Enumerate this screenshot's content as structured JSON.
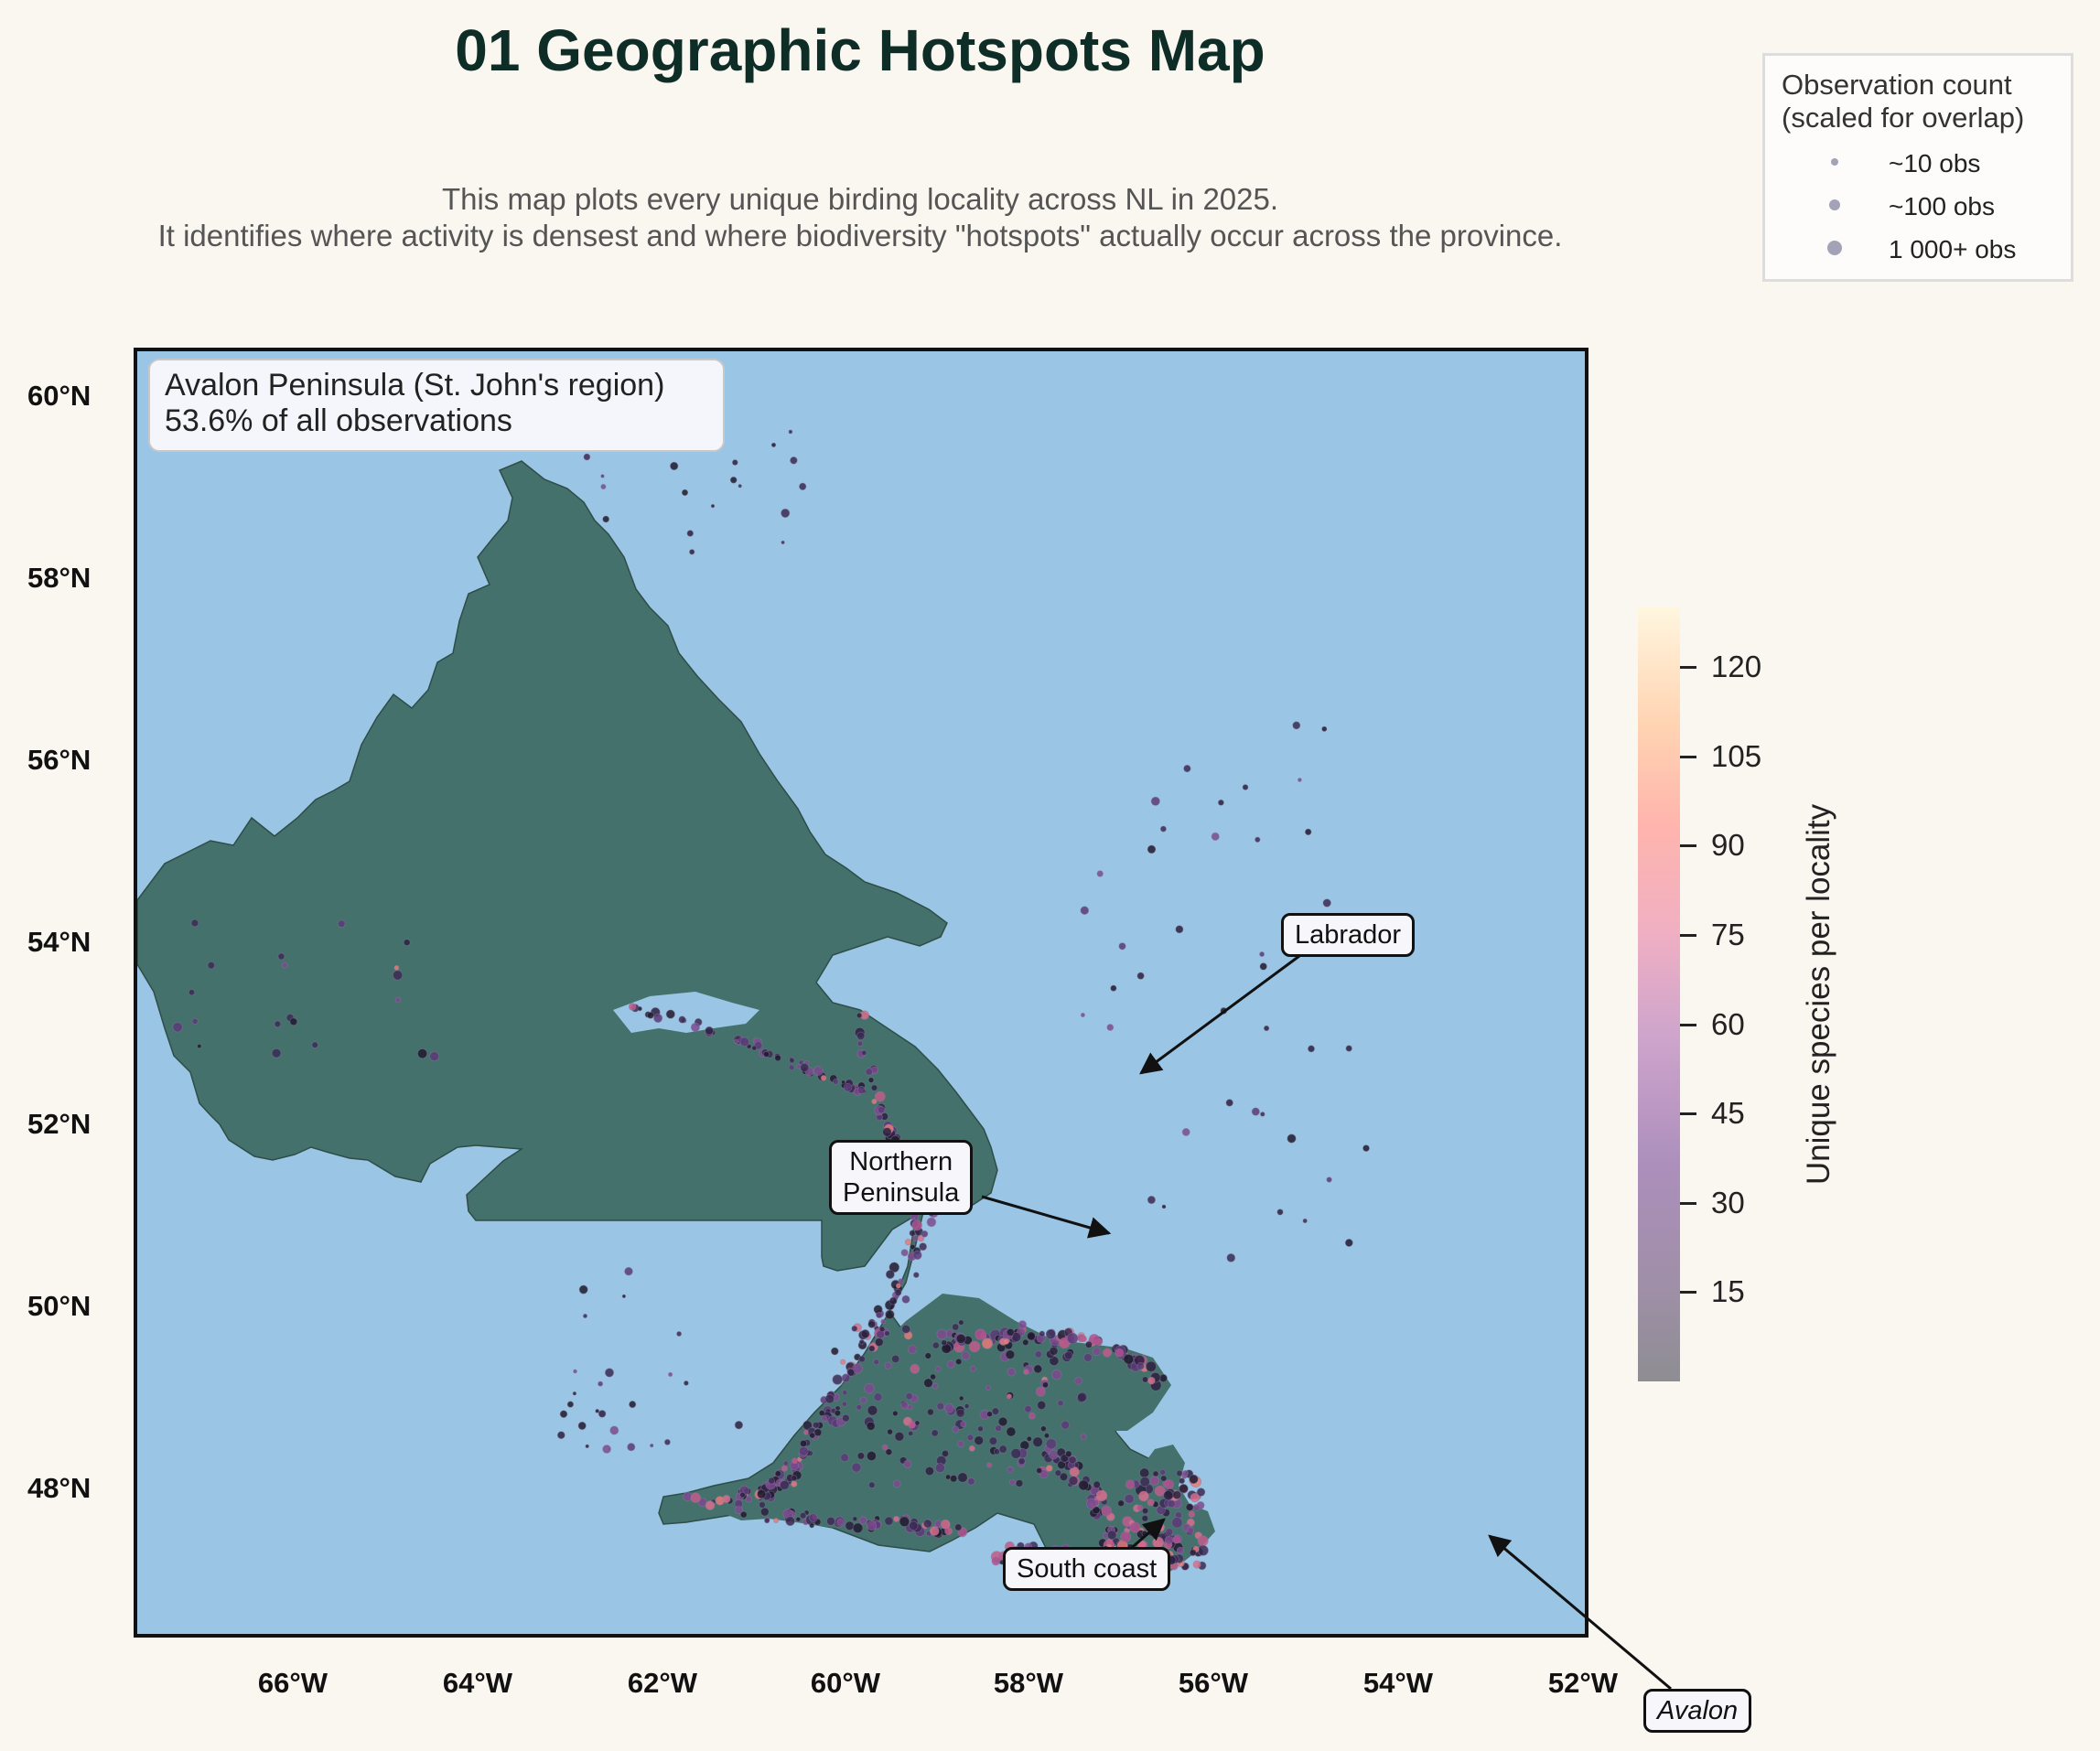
{
  "title": "01 Geographic Hotspots Map",
  "subtitle": {
    "line1": "This map plots every unique birding locality across NL in 2025.",
    "line2": "It identifies where activity is densest and where biodiversity \"hotspots\" actually occur across the province."
  },
  "legend": {
    "title_line1": "Observation count",
    "title_line2": "(scaled for overlap)",
    "items": [
      {
        "label": "~10 obs",
        "obs": 10
      },
      {
        "label": "~100 obs",
        "obs": 100
      },
      {
        "label": "1 000+ obs",
        "obs": 1000
      }
    ]
  },
  "inset": {
    "line1": "Avalon Peninsula (St. John's region)",
    "line2": "53.6% of all observations"
  },
  "annotations": [
    {
      "label": "Labrador",
      "style": "normal"
    },
    {
      "label_line1": "Northern",
      "label_line2": "Peninsula",
      "style": "normal"
    },
    {
      "label": "South coast",
      "style": "normal"
    },
    {
      "label": "Avalon",
      "style": "italic"
    }
  ],
  "axes": {
    "y_ticks": [
      "60°N",
      "58°N",
      "56°N",
      "54°N",
      "52°N",
      "50°N",
      "48°N"
    ],
    "x_ticks": [
      "66°W",
      "64°W",
      "62°W",
      "60°W",
      "58°W",
      "56°W",
      "54°W",
      "52°W"
    ]
  },
  "colorbar": {
    "label": "Unique species per locality",
    "ticks": [
      "15",
      "30",
      "45",
      "60",
      "75",
      "90",
      "105",
      "120"
    ]
  },
  "colors": {
    "ocean": "#9bc5e4",
    "land": "#45716d",
    "background": "#faf6f0",
    "title": "#0e2d27"
  }
}
